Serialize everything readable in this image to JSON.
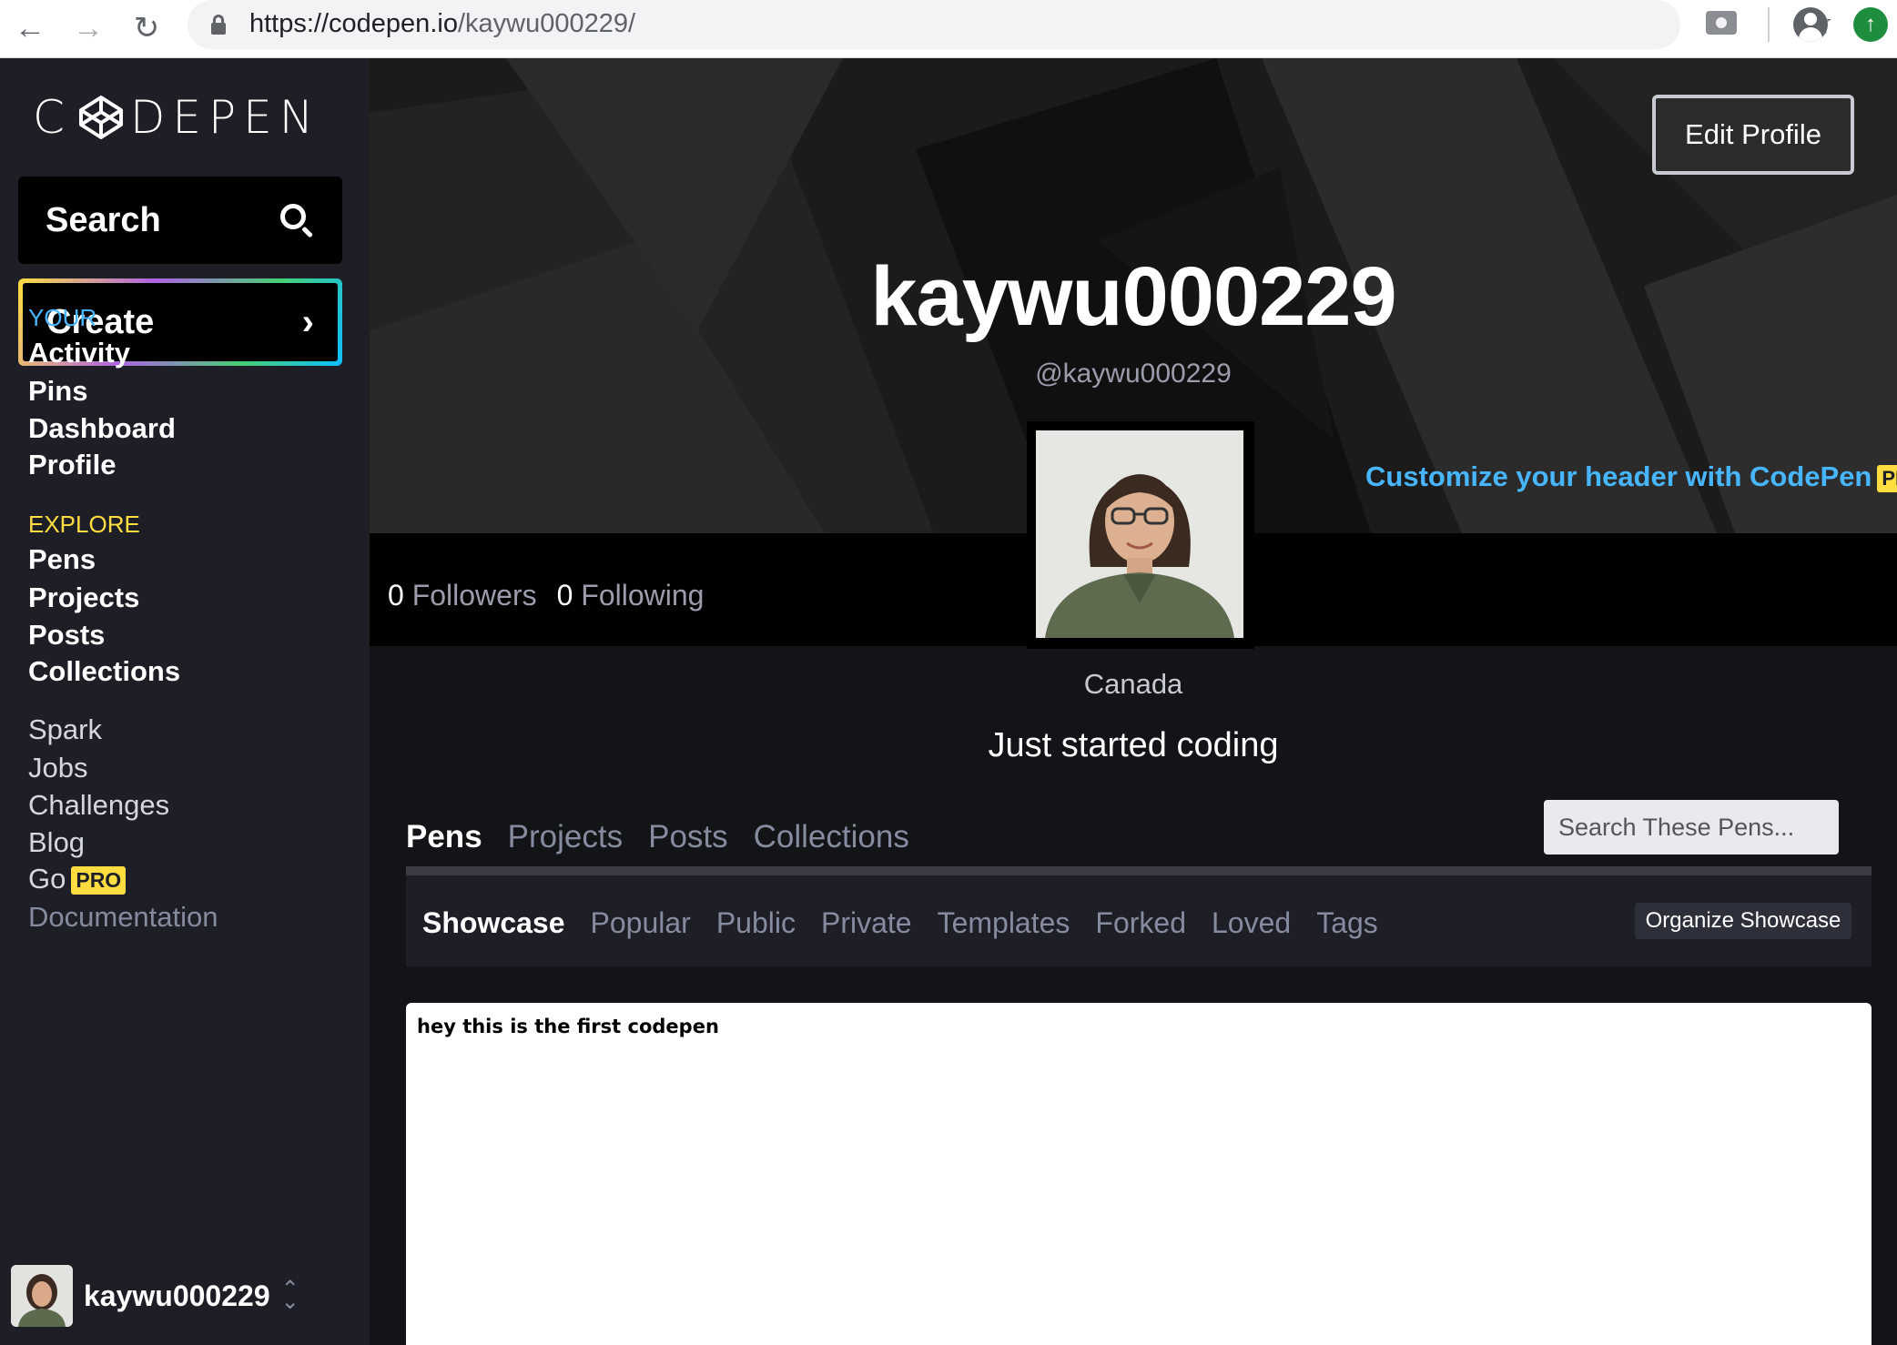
{
  "browser": {
    "url_host": "https://codepen.io",
    "url_path": "/kaywu000229/"
  },
  "sidebar": {
    "logo_left": "C",
    "logo_right": "DEPEN",
    "search_label": "Search",
    "create_label": "Create",
    "your_title": "YOUR",
    "your_items": [
      "Activity",
      "Pins",
      "Dashboard",
      "Profile"
    ],
    "explore_title": "EXPLORE",
    "explore_items": [
      "Pens",
      "Projects",
      "Posts",
      "Collections"
    ],
    "misc_items": [
      "Spark",
      "Jobs",
      "Challenges",
      "Blog",
      "Go"
    ],
    "go_badge": "PRO",
    "documentation": "Documentation",
    "username": "kaywu000229"
  },
  "profile": {
    "edit_label": "Edit Profile",
    "name": "kaywu000229",
    "handle": "@kaywu000229",
    "customize_text": "Customize your header with CodePen",
    "customize_badge": "PRO",
    "followers_count": "0",
    "followers_label": "Followers",
    "following_count": "0",
    "following_label": "Following",
    "location": "Canada",
    "bio": "Just started coding"
  },
  "tabs": {
    "items": [
      "Pens",
      "Projects",
      "Posts",
      "Collections"
    ],
    "active": "Pens",
    "search_placeholder": "Search These Pens..."
  },
  "subtabs": {
    "items": [
      "Showcase",
      "Popular",
      "Public",
      "Private",
      "Templates",
      "Forked",
      "Loved",
      "Tags"
    ],
    "active": "Showcase",
    "organize_label": "Organize Showcase"
  },
  "pen": {
    "preview_text": "hey this is the first codepen"
  },
  "colors": {
    "your_accent": "#47b6ff",
    "explore_accent": "#ffdd40",
    "pro_badge": "#ffdd40",
    "link_blue": "#47b6ff"
  }
}
